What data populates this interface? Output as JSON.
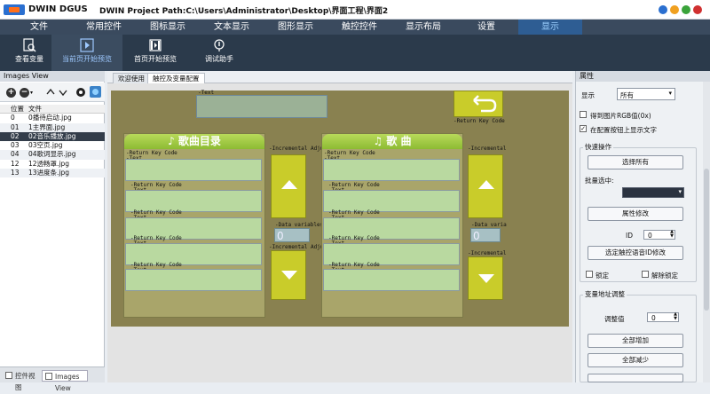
{
  "titlebar": {
    "app_name": "DWIN DGUS",
    "project_path": "DWIN Project Path:C:\\Users\\Administrator\\Desktop\\界面工程\\界面2"
  },
  "window_controls": {
    "colors": {
      "help": "#2a6fd0",
      "minimize": "#f0a020",
      "maximize": "#3aa33a",
      "close": "#d03030"
    }
  },
  "menu": [
    "文件",
    "常用控件",
    "图标显示",
    "文本显示",
    "图形显示",
    "触控控件",
    "显示布局",
    "设置",
    "显示"
  ],
  "menu_active": "显示",
  "toolbar": [
    {
      "label": "查看变量",
      "icon": "variable-search-icon"
    },
    {
      "label": "当前页开始预览",
      "icon": "play-preview-icon"
    },
    {
      "label": "首页开始预览",
      "icon": "film-preview-icon"
    },
    {
      "label": "调试助手",
      "icon": "debug-assistant-icon"
    }
  ],
  "left_panel": {
    "title": "Images View",
    "columns": [
      "位置",
      "文件"
    ],
    "rows": [
      [
        "0",
        "0播待启动.jpg"
      ],
      [
        "01",
        "1主界面.jpg"
      ],
      [
        "02",
        "02音乐播放.jpg"
      ],
      [
        "03",
        "03空页.jpg"
      ],
      [
        "04",
        "04歌词显示.jpg"
      ],
      [
        "12",
        "12透畅罩.jpg"
      ],
      [
        "13",
        "13进度条.jpg"
      ]
    ],
    "selected_index": 2,
    "footer_tabs": [
      "控件视图",
      "Images View"
    ]
  },
  "editor_tabs": [
    "欢迎使用",
    "触控及变量配置"
  ],
  "stage": {
    "text_label": "-Text",
    "return_key_label": "-Return Key Code",
    "incremental_label": "-Incremental Adjustment",
    "incremental_short": "-Incremental",
    "data_variable_label": "-Data variables",
    "data_var_short": "-Data varia",
    "data_variable_value": "0",
    "left_panel_title": "歌曲目录",
    "right_panel_title": "歌 曲",
    "combined_label": "-Return Key Code",
    "colors": {
      "background": "#898150",
      "panel_header": "#9fcb45",
      "list_row": "#b9d9a0",
      "button": "#c9cc2a"
    }
  },
  "right_panel": {
    "title": "属性",
    "display_label": "显示",
    "display_value": "所有",
    "checkbox_rgb": "得到图片RGB值(0x)",
    "checkbox_show_text": "在配置按钮上显示文字",
    "quick_ops_title": "快速操作",
    "select_all": "选择所有",
    "batch_select": "批量选中:",
    "attr_modify": "属性修改",
    "id_label": "ID",
    "id_value": "0",
    "id_modify": "选定触控语音ID修改",
    "lock": "锁定",
    "unlock": "解除锁定",
    "var_adjust_title": "变量地址调整",
    "adjust_value_label": "调整值",
    "adjust_value": "0",
    "all_increase": "全部增加",
    "all_decrease": "全部减少"
  }
}
